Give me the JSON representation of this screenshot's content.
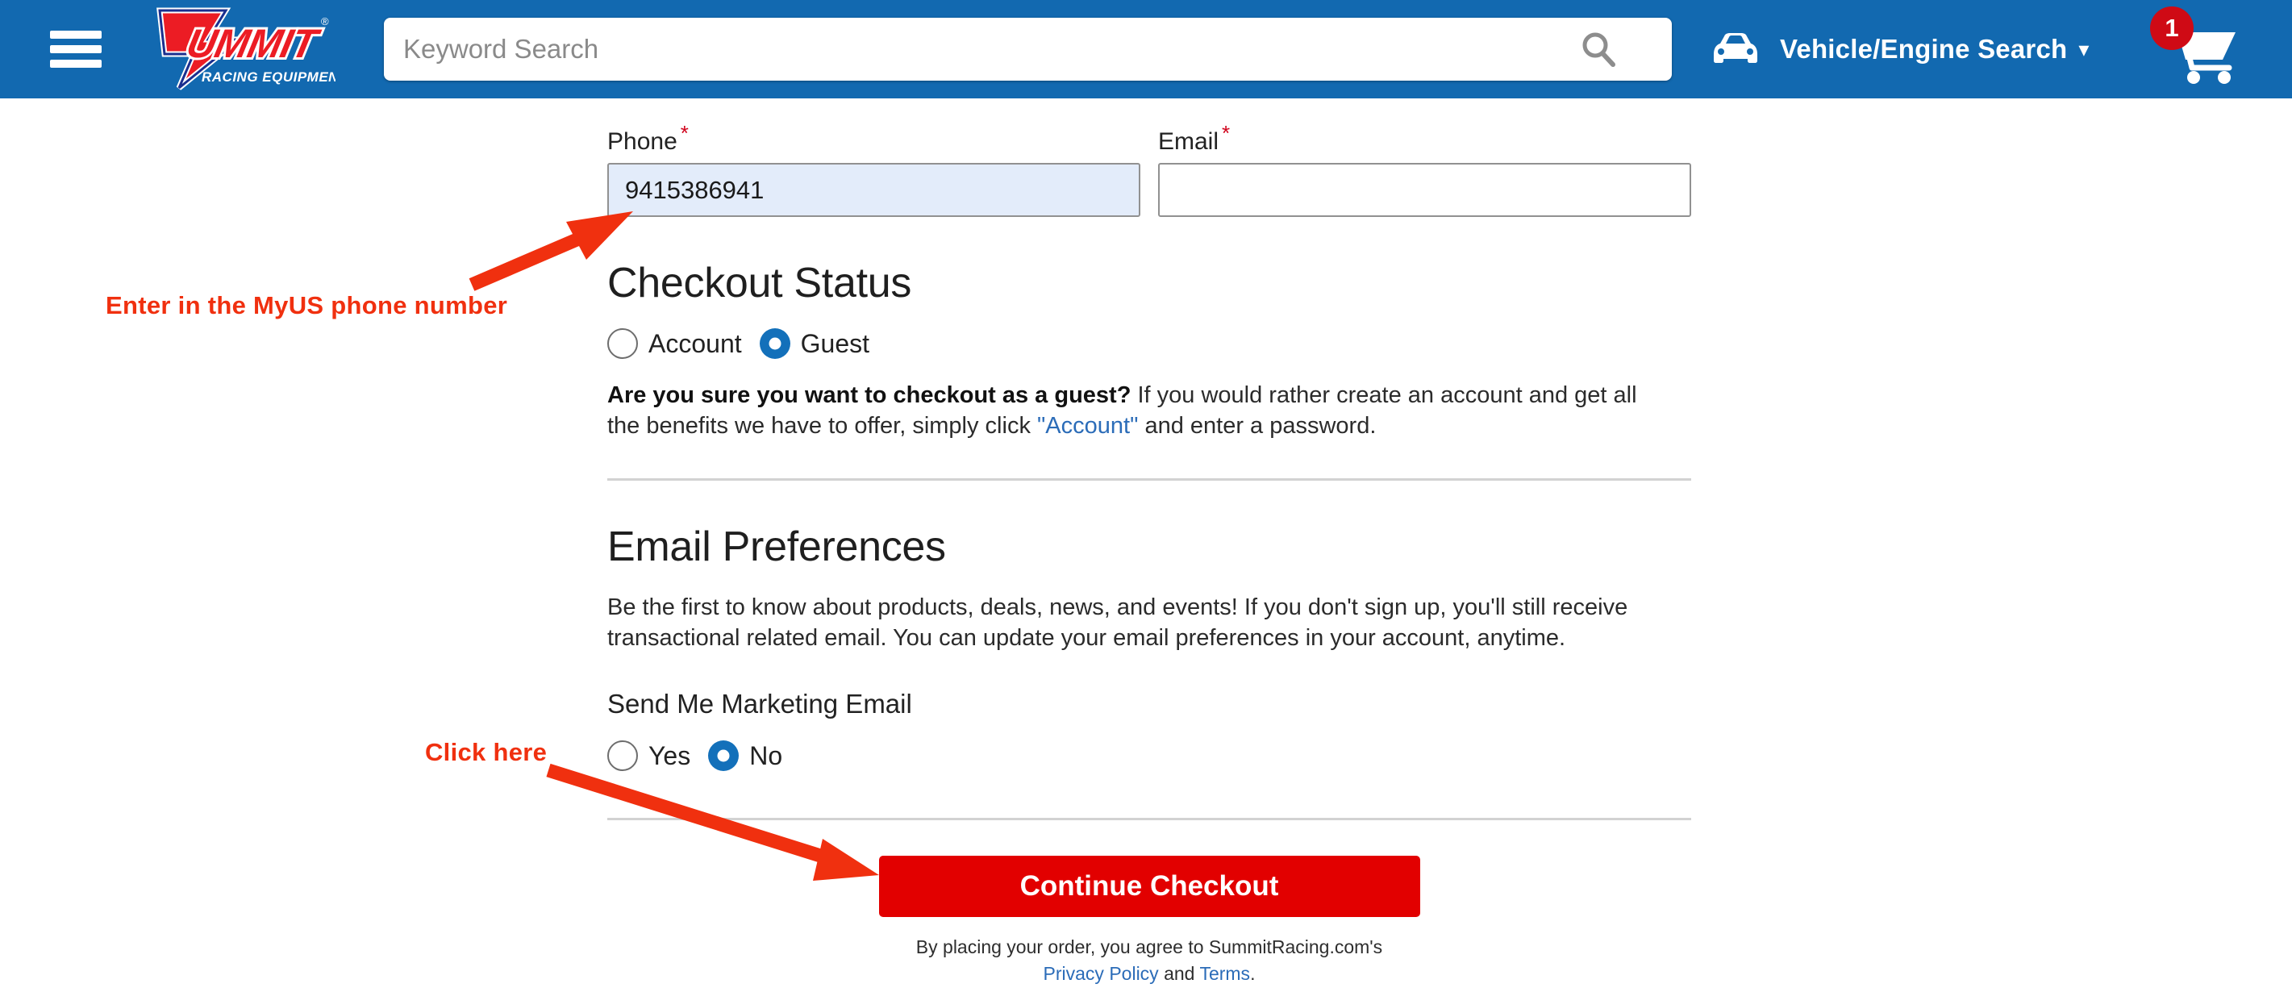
{
  "header": {
    "menu_icon": "hamburger-menu-icon",
    "logo": {
      "brand": "Summit",
      "tagline": "RACING EQUIPMENT",
      "trademark": "®"
    },
    "search": {
      "placeholder": "Keyword Search",
      "value": "",
      "icon": "search-icon"
    },
    "vehicle_search": {
      "label": "Vehicle/Engine Search",
      "icon": "car-icon",
      "chevron": "⌄"
    },
    "cart": {
      "icon": "shopping-cart-icon",
      "count": "1"
    },
    "background_color": "#1269b0"
  },
  "form": {
    "phone": {
      "label": "Phone",
      "required_mark": "*",
      "value": "9415386941",
      "placeholder": ""
    },
    "email": {
      "label": "Email",
      "required_mark": "*",
      "value": "",
      "placeholder": ""
    }
  },
  "checkout_status": {
    "title": "Checkout Status",
    "options": [
      {
        "label": "Account",
        "selected": false
      },
      {
        "label": "Guest",
        "selected": true
      }
    ],
    "note_bold": "Are you sure you want to checkout as a guest?",
    "note_rest_1": " If you would rather create an account and get all the benefits we have to offer, simply click ",
    "note_link": "\"Account\"",
    "note_rest_2": " and enter a password."
  },
  "email_preferences": {
    "title": "Email Preferences",
    "description": "Be the first to know about products, deals, news, and events! If you don't sign up, you'll still receive transactional related email. You can update your email preferences in your account, anytime.",
    "subheading": "Send Me Marketing Email",
    "options": [
      {
        "label": "Yes",
        "selected": false
      },
      {
        "label": "No",
        "selected": true
      }
    ]
  },
  "footer": {
    "continue_button": "Continue Checkout",
    "legal_prefix": "By placing your order, you agree to SummitRacing.com's",
    "privacy_link": "Privacy Policy",
    "legal_and": " and ",
    "terms_link": "Terms",
    "legal_period": "."
  },
  "annotations": {
    "phone_note": "Enter in the MyUS phone number",
    "click_note": "Click here",
    "color": "#f0300f"
  }
}
